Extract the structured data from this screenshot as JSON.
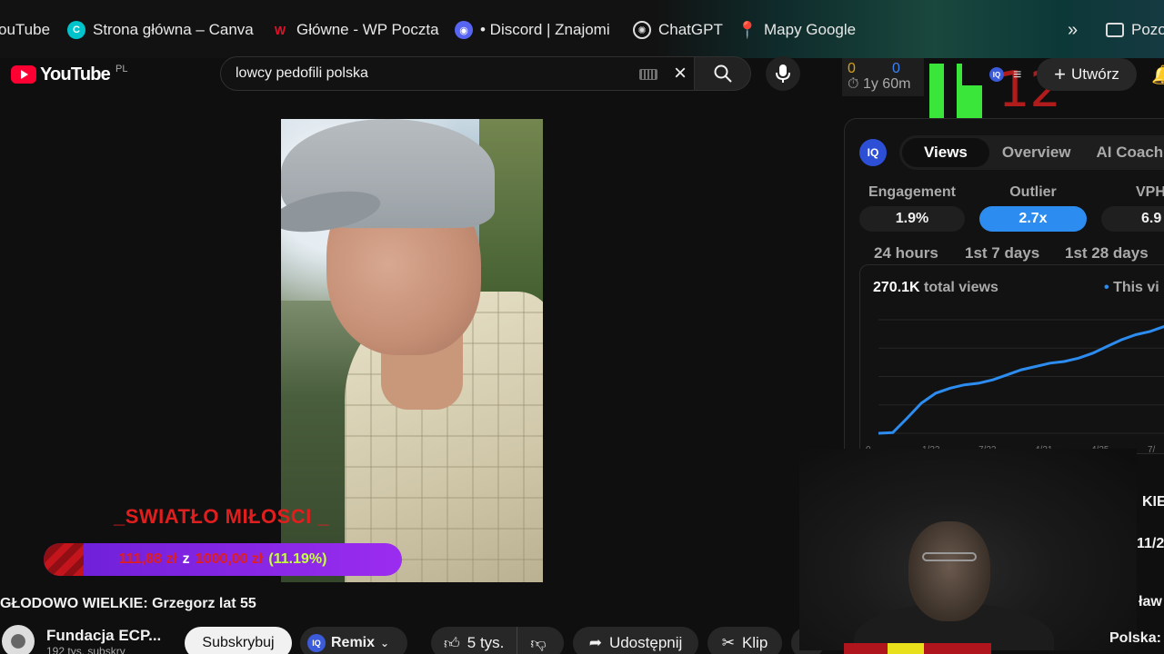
{
  "bookmarks": [
    {
      "label": "ouTube",
      "icon": "none"
    },
    {
      "label": "Strona główna – Canva",
      "icon": "canva-icon"
    },
    {
      "label": "Główne - WP Poczta",
      "icon": "wp-icon"
    },
    {
      "label": "• Discord | Znajomi",
      "icon": "discord-icon"
    },
    {
      "label": "ChatGPT",
      "icon": "chatgpt-icon"
    },
    {
      "label": "Mapy Google",
      "icon": "maps-pin-icon"
    },
    {
      "label": "Pozo",
      "icon": "folder-icon"
    }
  ],
  "header": {
    "logo_text": "YouTube",
    "country": "PL",
    "search_value": "lowcy pedofili polska",
    "timer": {
      "years": "0",
      "minutes": "0",
      "years_label": "1y",
      "minutes_label": "60m"
    },
    "k_digits": "12",
    "create_label": "Utwórz"
  },
  "video": {
    "stream_label": "_SWIATŁO MIŁOSCI _",
    "donation": {
      "amount": "111,88 zł",
      "z": "z",
      "goal": "1000,00 zł",
      "percent_text": "(11.19%)",
      "fraction": 0.1119
    },
    "title": "GŁODOWO WIELKIE: Grzegorz lat 55"
  },
  "channel": {
    "name": "Fundacja ECP...",
    "subs": "192 tys. subskry",
    "subscribe_label": "Subskrybuj",
    "remix_label": "Remix",
    "likes": "5 tys.",
    "share_label": "Udostępnij",
    "clip_label": "Klip",
    "more_label": "..."
  },
  "panel": {
    "tabs": [
      "Views",
      "Overview",
      "AI Coach"
    ],
    "metrics": [
      {
        "label": "Engagement",
        "value": "1.9%"
      },
      {
        "label": "Outlier",
        "value": "2.7x"
      },
      {
        "label": "VPH",
        "value": "6.9"
      }
    ],
    "ranges": [
      "24 hours",
      "1st 7 days",
      "1st 28 days"
    ],
    "total_views": "270.1K",
    "total_label": "total views",
    "legend": "This vi",
    "x_ticks": [
      "0",
      "1/22",
      "7/22",
      "4/21",
      "4/25",
      "7/"
    ]
  },
  "chart_data": {
    "type": "line",
    "title": "",
    "series": [
      {
        "name": "This vi",
        "values": [
          0,
          2,
          45,
          90,
          120,
          135,
          145,
          150,
          160,
          175,
          190,
          200,
          210,
          215,
          225,
          240,
          260,
          280,
          295,
          305,
          320,
          330
        ]
      }
    ],
    "x": [
      0,
      1,
      2,
      3,
      4,
      5,
      6,
      7,
      8,
      9,
      10,
      11,
      12,
      13,
      14,
      15,
      16,
      17,
      18,
      19,
      20,
      21
    ],
    "ylim": [
      0,
      340
    ],
    "grid": true,
    "color": "#2d8cf0"
  },
  "side": {
    "peek1": "KIE:",
    "peek2": "11/2",
    "peek3": "ław",
    "peek4": "Polska:"
  },
  "colors": {
    "accent": "#2d8cf0",
    "brand": "#ff0033",
    "donation_text": "#e01e1e"
  }
}
